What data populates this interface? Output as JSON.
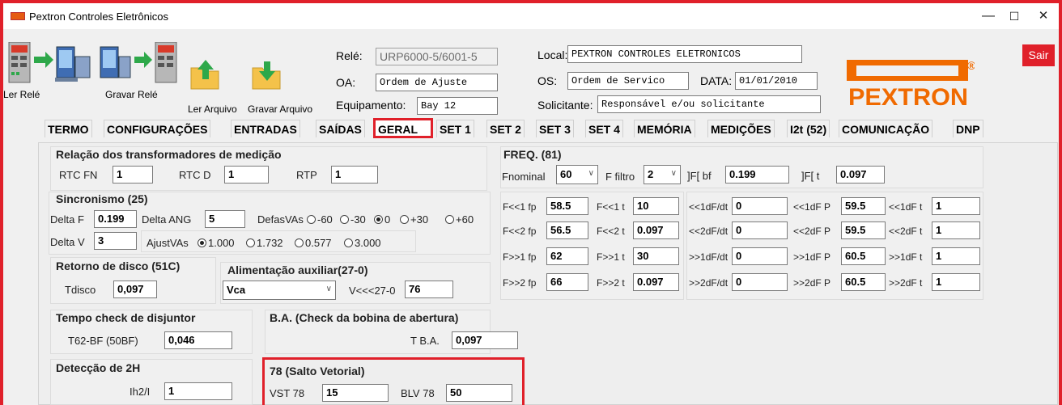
{
  "window": {
    "title": "Pextron Controles Eletrônicos",
    "minimize": "—",
    "maximize": "☐",
    "close": "✕"
  },
  "toolbar": {
    "ler_rele": "Ler Relé",
    "gravar_rele": "Gravar Relé",
    "ler_arquivo": "Ler Arquivo",
    "gravar_arquivo": "Gravar Arquivo",
    "rele_label": "Relé:",
    "rele_value": "URP6000-5/6001-5",
    "oa_label": "OA:",
    "oa_value": "Ordem de Ajuste",
    "equip_label": "Equipamento:",
    "equip_value": "Bay 12",
    "local_label": "Local:",
    "local_value": "PEXTRON CONTROLES ELETRONICOS",
    "os_label": "OS:",
    "os_value": "Ordem de Servico",
    "data_label": "DATA:",
    "data_value": "01/01/2010",
    "solic_label": "Solicitante:",
    "solic_value": "Responsável e/ou solicitante",
    "brand": "PEXTRON",
    "sair": "Sair"
  },
  "tabs": [
    "TERMO",
    "CONFIGURAÇÕES",
    "ENTRADAS",
    "SAÍDAS",
    "GERAL",
    "SET 1",
    "SET 2",
    "SET 3",
    "SET 4",
    "MEMÓRIA",
    "MEDIÇÕES",
    "I2t (52)",
    "COMUNICAÇÃO",
    "DNP"
  ],
  "geral": {
    "rel_title": "Relação dos transformadores de medição",
    "rtcfn_label": "RTC FN",
    "rtcfn": "1",
    "rtcd_label": "RTC D",
    "rtcd": "1",
    "rtp_label": "RTP",
    "rtp": "1",
    "sinc_title": "Sincronismo (25)",
    "deltaf_label": "Delta F",
    "deltaf": "0.199",
    "deltaang_label": "Delta ANG",
    "deltaang": "5",
    "defas_label": "DefasVAs",
    "defas_opts": [
      "-60",
      "-30",
      "0",
      "+30",
      "+60"
    ],
    "deltav_label": "Delta V",
    "deltav": "3",
    "ajust_label": "AjustVAs",
    "ajust_opts": [
      "1.000",
      "1.732",
      "0.577",
      "3.000"
    ],
    "ret_title": "Retorno de disco (51C)",
    "tdisco_label": "Tdisco",
    "tdisco": "0,097",
    "alim_title": "Alimentação auxiliar(27-0)",
    "alim_select": "Vca",
    "v27_label": "V<<<27-0",
    "v27": "76",
    "tempo_title": "Tempo check de disjuntor",
    "t62_label": "T62-BF (50BF)",
    "t62": "0,046",
    "ba_title": "B.A. (Check da bobina de abertura)",
    "tba_label": "T B.A.",
    "tba": "0,097",
    "det_title": "Detecção de 2H",
    "ih2_label": "Ih2/I",
    "ih2": "1",
    "salto_title": "78 (Salto Vetorial)",
    "vst_label": "VST 78",
    "vst": "15",
    "blv_label": "BLV 78",
    "blv": "50"
  },
  "freq": {
    "title": "FREQ. (81)",
    "fnom_label": "Fnominal",
    "fnom": "60",
    "ffiltro_label": "F filtro",
    "ffiltro": "2",
    "fbf_label": "]F[ bf",
    "fbf": "0.199",
    "ft_label": "]F[ t",
    "ft": "0.097",
    "rows": [
      {
        "fp_label": "F<<1 fp",
        "fp": "58.5",
        "t_label": "F<<1 t",
        "t": "10",
        "dfdt_label": "<<1dF/dt",
        "dfdt": "0",
        "dfp_label": "<<1dF P",
        "dfp": "59.5",
        "dft_label": "<<1dF t",
        "dft": "1"
      },
      {
        "fp_label": "F<<2 fp",
        "fp": "56.5",
        "t_label": "F<<2 t",
        "t": "0.097",
        "dfdt_label": "<<2dF/dt",
        "dfdt": "0",
        "dfp_label": "<<2dF P",
        "dfp": "59.5",
        "dft_label": "<<2dF t",
        "dft": "1"
      },
      {
        "fp_label": "F>>1 fp",
        "fp": "62",
        "t_label": "F>>1 t",
        "t": "30",
        "dfdt_label": ">>1dF/dt",
        "dfdt": "0",
        "dfp_label": ">>1dF P",
        "dfp": "60.5",
        "dft_label": ">>1dF t",
        "dft": "1"
      },
      {
        "fp_label": "F>>2 fp",
        "fp": "66",
        "t_label": "F>>2 t",
        "t": "0.097",
        "dfdt_label": ">>2dF/dt",
        "dfdt": "0",
        "dfp_label": ">>2dF P",
        "dfp": "60.5",
        "dft_label": ">>2dF t",
        "dft": "1"
      }
    ]
  },
  "colors": {
    "accent_red": "#e0202a",
    "brand_orange": "#f06a00",
    "folder_yellow": "#f4c24a",
    "arrow_green": "#2ea84a"
  }
}
